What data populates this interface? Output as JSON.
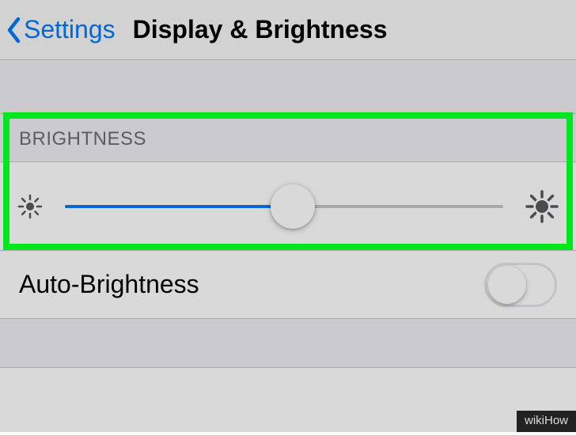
{
  "header": {
    "back_label": "Settings",
    "title": "Display & Brightness"
  },
  "sections": {
    "brightness_header": "BRIGHTNESS",
    "slider_value_percent": 52,
    "auto_brightness_label": "Auto-Brightness",
    "auto_brightness_on": false
  },
  "watermark": "wikiHow",
  "colors": {
    "accent": "#007aff",
    "highlight": "#00e61f"
  }
}
